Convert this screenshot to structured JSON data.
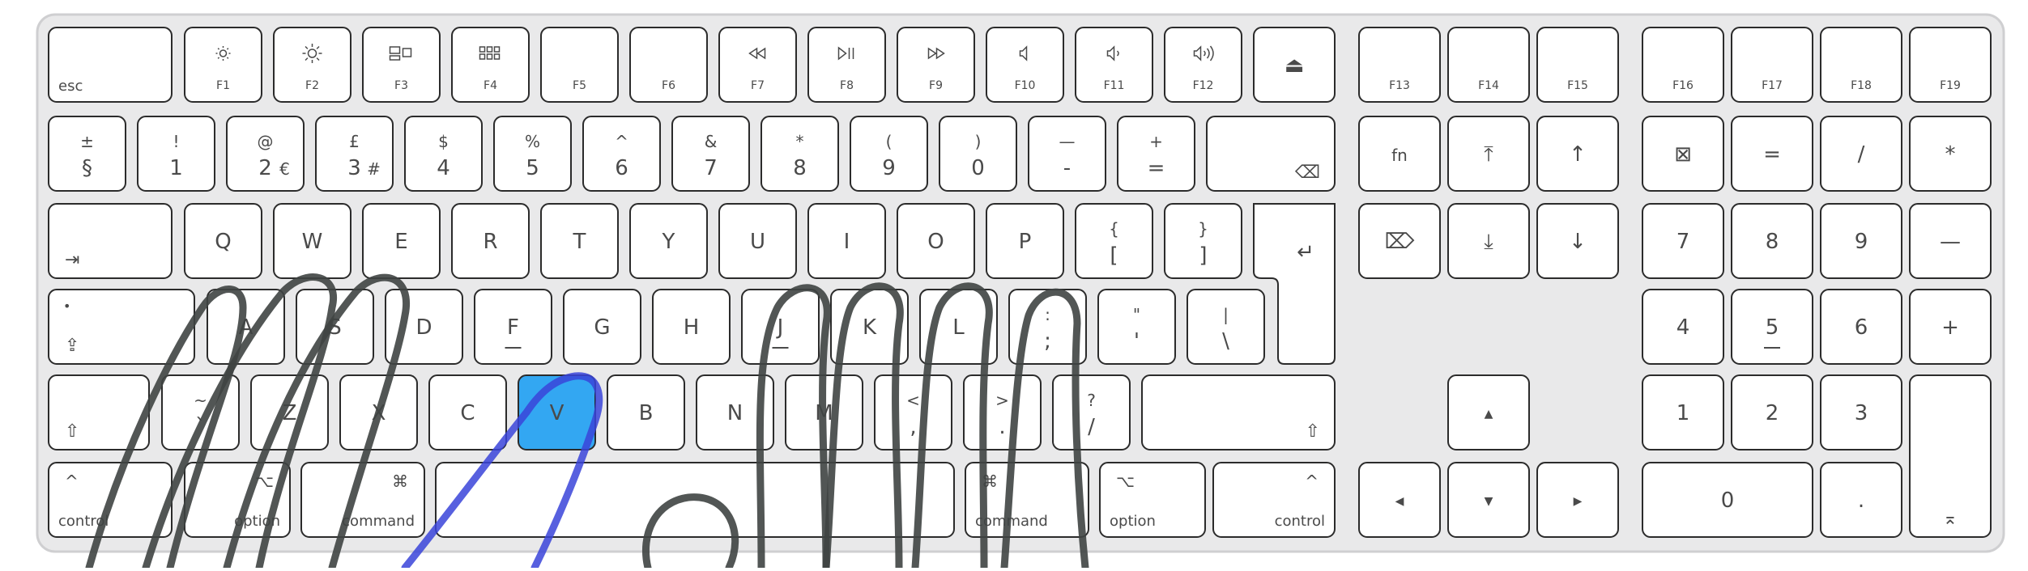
{
  "keyboard": {
    "colors": {
      "body": "#e9e9ea",
      "body_edge": "#cfcfd1",
      "key": "#ffffff",
      "key_border": "#2b2b2b",
      "legend": "#4a4a4a",
      "highlight": "#33a7f2",
      "finger_stroke": "#3f4443",
      "thumb_stroke": "#3a44d9"
    },
    "highlighted_key": "V",
    "keys": {
      "esc": {
        "main": "esc"
      },
      "f1": {
        "main": "F1",
        "icon": "brightness-down-icon"
      },
      "f2": {
        "main": "F2",
        "icon": "brightness-up-icon"
      },
      "f3": {
        "main": "F3",
        "icon": "mission-control-icon"
      },
      "f4": {
        "main": "F4",
        "icon": "launchpad-icon"
      },
      "f5": {
        "main": "F5"
      },
      "f6": {
        "main": "F6"
      },
      "f7": {
        "main": "F7",
        "icon": "rewind-icon"
      },
      "f8": {
        "main": "F8",
        "icon": "play-pause-icon"
      },
      "f9": {
        "main": "F9",
        "icon": "fast-forward-icon"
      },
      "f10": {
        "main": "F10",
        "icon": "mute-icon"
      },
      "f11": {
        "main": "F11",
        "icon": "volume-down-icon"
      },
      "f12": {
        "main": "F12",
        "icon": "volume-up-icon"
      },
      "eject": {
        "main": "⏏"
      },
      "f13": {
        "main": "F13"
      },
      "f14": {
        "main": "F14"
      },
      "f15": {
        "main": "F15"
      },
      "f16": {
        "main": "F16"
      },
      "f17": {
        "main": "F17"
      },
      "f18": {
        "main": "F18"
      },
      "f19": {
        "main": "F19"
      },
      "section": {
        "top": "±",
        "bottom": "§"
      },
      "d1": {
        "top": "!",
        "bottom": "1"
      },
      "d2": {
        "top": "@",
        "bottom": "2",
        "alt": "€"
      },
      "d3": {
        "top": "£",
        "bottom": "3",
        "alt": "#"
      },
      "d4": {
        "top": "$",
        "bottom": "4"
      },
      "d5": {
        "top": "%",
        "bottom": "5"
      },
      "d6": {
        "top": "^",
        "bottom": "6"
      },
      "d7": {
        "top": "&",
        "bottom": "7"
      },
      "d8": {
        "top": "*",
        "bottom": "8"
      },
      "d9": {
        "top": "(",
        "bottom": "9"
      },
      "d0": {
        "top": ")",
        "bottom": "0"
      },
      "minus": {
        "top": "—",
        "bottom": "-"
      },
      "equals": {
        "top": "+",
        "bottom": "="
      },
      "backspace": {
        "main": "⌫"
      },
      "fn": {
        "main": "fn"
      },
      "home": {
        "main": "⤒"
      },
      "pageup": {
        "main": "↑"
      },
      "clear": {
        "main": "⊠"
      },
      "np_eq": {
        "main": "="
      },
      "np_div": {
        "main": "/"
      },
      "np_mul": {
        "main": "*"
      },
      "tab": {
        "main": "⇥"
      },
      "q": {
        "main": "Q"
      },
      "w": {
        "main": "W"
      },
      "e": {
        "main": "E"
      },
      "r": {
        "main": "R"
      },
      "t": {
        "main": "T"
      },
      "y": {
        "main": "Y"
      },
      "u": {
        "main": "U"
      },
      "i": {
        "main": "I"
      },
      "o": {
        "main": "O"
      },
      "p": {
        "main": "P"
      },
      "lbracket": {
        "top": "{",
        "bottom": "["
      },
      "rbracket": {
        "top": "}",
        "bottom": "]"
      },
      "enter": {
        "main": "↵"
      },
      "fwd_delete": {
        "main": "⌦"
      },
      "end": {
        "main": "⤓"
      },
      "pagedown": {
        "main": "↓"
      },
      "np7": {
        "main": "7"
      },
      "np8": {
        "main": "8"
      },
      "np9": {
        "main": "9"
      },
      "np_minus": {
        "main": "—"
      },
      "capslock": {
        "main": "⇪",
        "dot": "•"
      },
      "a": {
        "main": "A"
      },
      "s": {
        "main": "S"
      },
      "d": {
        "main": "D"
      },
      "f": {
        "main": "F"
      },
      "g": {
        "main": "G"
      },
      "h": {
        "main": "H"
      },
      "j": {
        "main": "J"
      },
      "k": {
        "main": "K"
      },
      "l": {
        "main": "L"
      },
      "semicolon": {
        "top": ":",
        "bottom": ";"
      },
      "quote": {
        "top": "\"",
        "bottom": "'"
      },
      "backslash": {
        "top": "|",
        "bottom": "\\"
      },
      "np4": {
        "main": "4"
      },
      "np5": {
        "main": "5"
      },
      "np6": {
        "main": "6"
      },
      "np_plus": {
        "main": "+"
      },
      "lshift": {
        "main": "⇧"
      },
      "grave": {
        "top": "~",
        "bottom": "`"
      },
      "z": {
        "main": "Z"
      },
      "x": {
        "main": "X"
      },
      "c": {
        "main": "C"
      },
      "v": {
        "main": "V"
      },
      "b": {
        "main": "B"
      },
      "n": {
        "main": "N"
      },
      "m": {
        "main": "M"
      },
      "comma": {
        "top": "<",
        "bottom": ","
      },
      "period": {
        "top": ">",
        "bottom": "."
      },
      "slash": {
        "top": "?",
        "bottom": "/"
      },
      "rshift": {
        "main": "⇧"
      },
      "up": {
        "main": "▲"
      },
      "np1": {
        "main": "1"
      },
      "np2": {
        "main": "2"
      },
      "np3": {
        "main": "3"
      },
      "lcontrol": {
        "icon": "^",
        "label": "control"
      },
      "loption": {
        "icon": "⌥",
        "label": "option"
      },
      "lcommand": {
        "icon": "⌘",
        "label": "command"
      },
      "space": {
        "main": ""
      },
      "rcommand": {
        "icon": "⌘",
        "label": "command"
      },
      "roption": {
        "icon": "⌥",
        "label": "option"
      },
      "rcontrol": {
        "icon": "^",
        "label": "control"
      },
      "left": {
        "main": "◀"
      },
      "down": {
        "main": "▼"
      },
      "right": {
        "main": "▶"
      },
      "np0": {
        "main": "0"
      },
      "np_dot": {
        "main": "."
      },
      "np_enter": {
        "main": "⌅"
      }
    }
  }
}
